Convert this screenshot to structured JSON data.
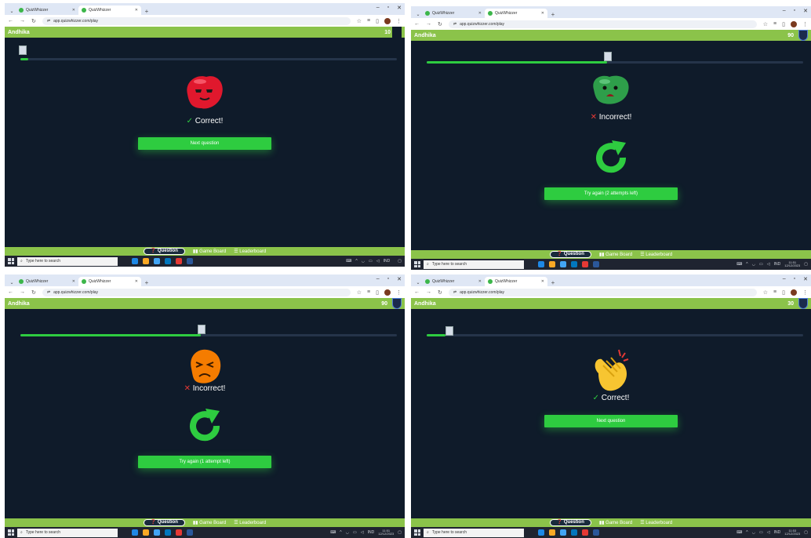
{
  "panels": [
    {
      "tabs": [
        {
          "label": "QuizWhizzer"
        },
        {
          "label": "QuizWhizzer"
        }
      ],
      "url": "app.quizwhizzer.com/play",
      "player": "Andhika",
      "score": "10",
      "progress": 0.02,
      "result_mark": "✓",
      "result_text": "Correct!",
      "button_label": "Next question",
      "tabs_bottom": {
        "question": "Question",
        "game_board": "Game Board",
        "leaderboard": "Leaderboard"
      },
      "search_placeholder": "Type here to search",
      "time": "",
      "date": ""
    },
    {
      "tabs": [
        {
          "label": "QuizWhizzer"
        },
        {
          "label": "QuizWhizzer"
        }
      ],
      "url": "app.quizwhizzer.com/play",
      "player": "Andhika",
      "score": "90",
      "progress": 0.48,
      "result_mark": "✕",
      "result_text": "Incorrect!",
      "button_label": "Try again (2 attempts left)",
      "tabs_bottom": {
        "question": "Question",
        "game_board": "Game Board",
        "leaderboard": "Leaderboard"
      },
      "search_placeholder": "Type here to search",
      "tray_lang": "IND",
      "time": "11:51",
      "date": "12/12/2023"
    },
    {
      "tabs": [
        {
          "label": "QuizWhizzer"
        },
        {
          "label": "QuizWhizzer"
        }
      ],
      "url": "app.quizwhizzer.com/play",
      "player": "Andhika",
      "score": "90",
      "progress": 0.48,
      "result_mark": "✕",
      "result_text": "Incorrect!",
      "button_label": "Try again (1 attempt left)",
      "tabs_bottom": {
        "question": "Question",
        "game_board": "Game Board",
        "leaderboard": "Leaderboard"
      },
      "search_placeholder": "Type here to search",
      "tray_lang": "IND",
      "time": "11:51",
      "date": "12/12/2023"
    },
    {
      "tabs": [
        {
          "label": "QuizWhizzer"
        },
        {
          "label": "QuizWhizzer"
        }
      ],
      "url": "app.quizwhizzer.com/play",
      "player": "Andhika",
      "score": "30",
      "progress": 0.05,
      "result_mark": "✓",
      "result_text": "Correct!",
      "button_label": "Next question",
      "tabs_bottom": {
        "question": "Question",
        "game_board": "Game Board",
        "leaderboard": "Leaderboard"
      },
      "search_placeholder": "Type here to search",
      "tray_lang": "IND",
      "time": "11:53",
      "date": "12/12/2023"
    }
  ],
  "colors": {
    "accent_green": "#2ecc40",
    "bar_green": "#8bc34a",
    "bg": "#0f1b2a",
    "error_red": "#e53935"
  }
}
